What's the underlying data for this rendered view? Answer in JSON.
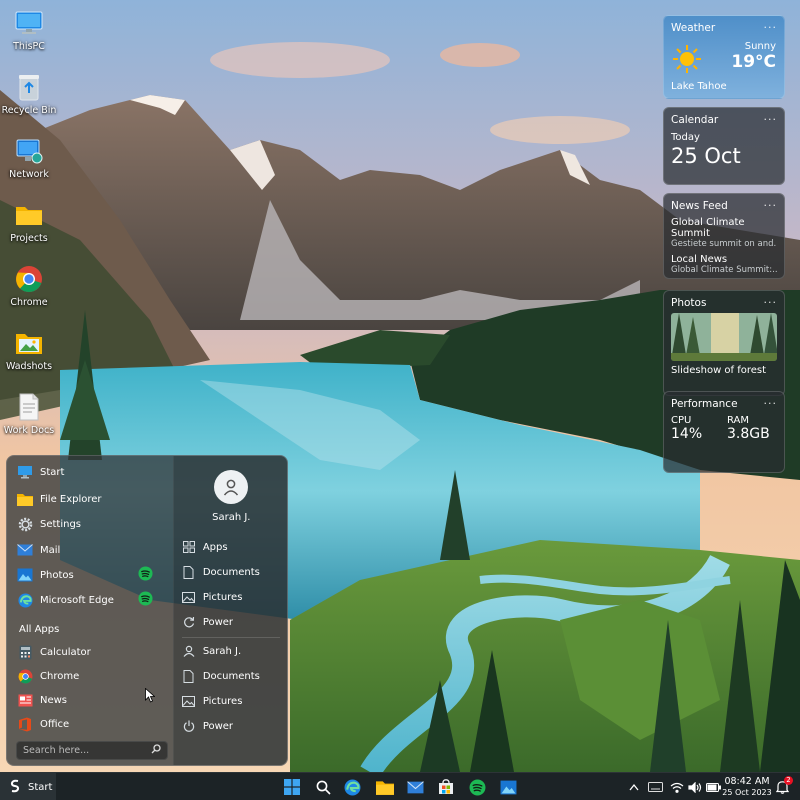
{
  "desktop": {
    "icons": [
      {
        "label": "ThisPC",
        "icon": "monitor-icon"
      },
      {
        "label": "Recycle Bin",
        "icon": "recycle-bin-icon"
      },
      {
        "label": "Network",
        "icon": "network-icon"
      },
      {
        "label": "Projects",
        "icon": "folder-icon"
      },
      {
        "label": "Chrome",
        "icon": "chrome-icon"
      },
      {
        "label": "Wadshots",
        "icon": "folder-image-icon"
      },
      {
        "label": "Work Docs",
        "icon": "document-icon"
      }
    ]
  },
  "widgets": {
    "weather": {
      "title": "Weather",
      "condition": "Sunny",
      "temp": "19°C",
      "location": "Lake Tahoe",
      "icon": "sun-icon"
    },
    "calendar": {
      "title": "Calendar",
      "label": "Today",
      "date": "25 Oct"
    },
    "news": {
      "title": "News Feed",
      "items": [
        {
          "headline": "Global Climate Summit",
          "snippet": "Gestiete summit on and..."
        },
        {
          "headline": "Local News",
          "snippet": "Global Climate Summit:..."
        }
      ]
    },
    "photos": {
      "title": "Photos",
      "caption": "Slideshow of forest"
    },
    "performance": {
      "title": "Performance",
      "cpu_label": "CPU",
      "cpu_value": "14%",
      "ram_label": "RAM",
      "ram_value": "3.8GB"
    },
    "more_glyph": "···"
  },
  "start_menu": {
    "header": "Start",
    "pinned": [
      {
        "label": "File Explorer",
        "icon": "folder-icon"
      },
      {
        "label": "Settings",
        "icon": "gear-icon"
      },
      {
        "label": "Mail",
        "icon": "mail-icon"
      },
      {
        "label": "Photos",
        "icon": "photos-icon",
        "badge": "spotify-icon"
      },
      {
        "label": "Microsoft Edge",
        "icon": "edge-icon",
        "badge": "spotify-icon"
      }
    ],
    "all_apps_title": "All Apps",
    "all_apps": [
      {
        "label": "Calculator",
        "icon": "calculator-icon"
      },
      {
        "label": "Chrome",
        "icon": "chrome-icon"
      },
      {
        "label": "News",
        "icon": "news-icon"
      },
      {
        "label": "Office",
        "icon": "office-icon"
      }
    ],
    "search_placeholder": "Search here...",
    "user": {
      "name": "Sarah J."
    },
    "right_top": [
      {
        "label": "Apps",
        "icon": "apps-grid-icon"
      },
      {
        "label": "Documents",
        "icon": "document-icon"
      },
      {
        "label": "Pictures",
        "icon": "picture-icon"
      },
      {
        "label": "Power",
        "icon": "refresh-icon"
      }
    ],
    "right_bottom": [
      {
        "label": "Sarah J.",
        "icon": "user-icon"
      },
      {
        "label": "Documents",
        "icon": "document-icon"
      },
      {
        "label": "Pictures",
        "icon": "picture-icon"
      },
      {
        "label": "Power",
        "icon": "power-icon"
      }
    ]
  },
  "taskbar": {
    "start_label": "Start",
    "apps": [
      "windows-icon",
      "search-icon",
      "edge-icon",
      "file-explorer-icon",
      "mail-icon",
      "store-icon",
      "spotify-icon",
      "photos-icon"
    ],
    "time": "08:42 AM",
    "date": "25 Oct 2023",
    "notification_count": "2"
  },
  "colors": {
    "accent": "#2f9be8",
    "spotify": "#1db954",
    "badge": "#e81123"
  }
}
